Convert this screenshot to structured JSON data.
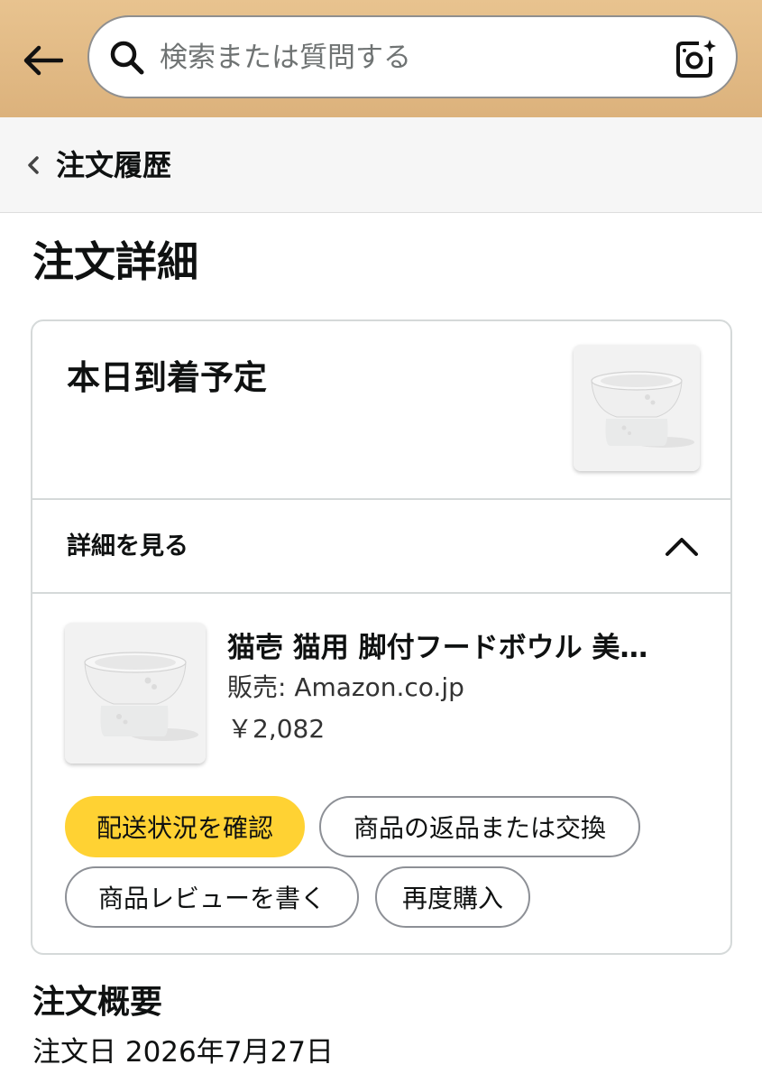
{
  "header": {
    "back_icon": "back-arrow-icon",
    "search_placeholder": "検索または質問する",
    "search_icon": "search-icon",
    "camera_icon": "camera-sparkle-icon",
    "background_color": "#dcb27c"
  },
  "breadcrumb": {
    "label": "注文履歴",
    "icon": "chevron-left-icon"
  },
  "page": {
    "title": "注文詳細"
  },
  "order_card": {
    "delivery_status": "本日到着予定",
    "details_toggle_label": "詳細を見る",
    "details_expanded": true,
    "item": {
      "title": "猫壱 猫用 脚付フードボウル 美…",
      "seller": "販売: Amazon.co.jp",
      "price": "￥2,082"
    },
    "actions": {
      "track": "配送状況を確認",
      "return": "商品の返品または交換",
      "review": "商品レビューを書く",
      "buy_again": "再度購入"
    },
    "primary_color": "#ffd233"
  },
  "summary": {
    "title": "注文概要",
    "order_date": "注文日 2026年7月27日"
  }
}
